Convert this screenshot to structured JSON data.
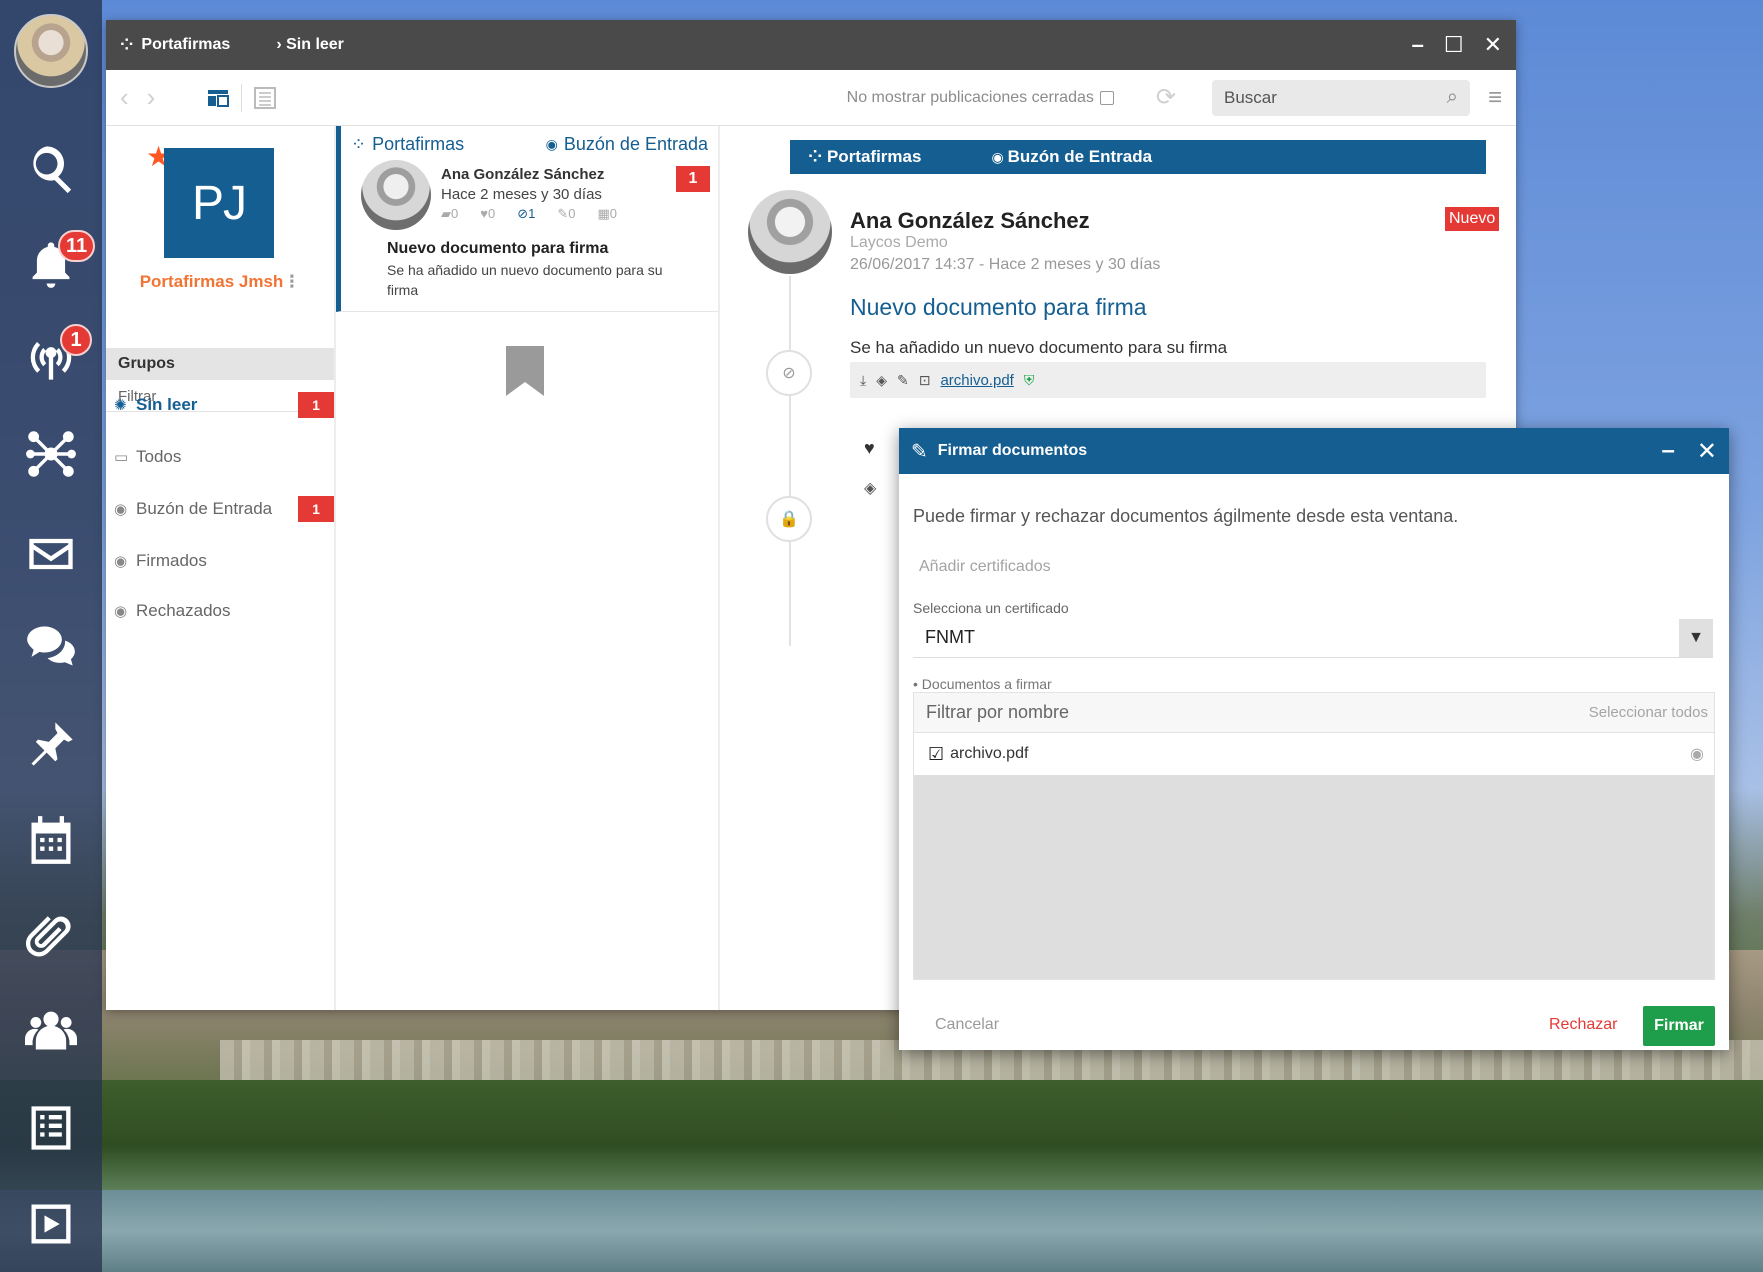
{
  "dock": {
    "notifications_badge": "11",
    "antenna_badge": "1",
    "items": [
      "search-icon",
      "bell-icon",
      "antenna-icon",
      "network-icon",
      "mail-icon",
      "chat-icon",
      "pin-icon",
      "calendar-icon",
      "paperclip-icon",
      "group-icon",
      "list-icon",
      "play-icon"
    ]
  },
  "window": {
    "app_title": "Portafirmas",
    "breadcrumb": "› Sin leer",
    "toolbar": {
      "hide_closed_label": "No mostrar publicaciones cerradas",
      "search_placeholder": "Buscar"
    }
  },
  "profile": {
    "initials": "PJ",
    "name": "Portafirmas Jmsh"
  },
  "groups": {
    "header": "Grupos",
    "filter_placeholder": "Filtrar",
    "items": [
      {
        "label": "Sin leer",
        "badge": "1"
      },
      {
        "label": "Todos",
        "badge": ""
      },
      {
        "label": "Buzón de Entrada",
        "badge": "1"
      },
      {
        "label": "Firmados",
        "badge": ""
      },
      {
        "label": "Rechazados",
        "badge": ""
      }
    ]
  },
  "message_list": {
    "card": {
      "source": "Portafirmas",
      "inbox": "Buzón de Entrada",
      "author": "Ana González Sánchez",
      "time": "Hace 2 meses y 30 días",
      "stats": {
        "comments": "0",
        "likes": "0",
        "attachments": "1",
        "pins": "0",
        "events": "0"
      },
      "badge": "1",
      "title": "Nuevo documento para firma",
      "description": "Se ha añadido un nuevo documento para su firma"
    }
  },
  "detail": {
    "source": "Portafirmas",
    "inbox": "Buzón de Entrada",
    "author": "Ana González Sánchez",
    "organization": "Laycos Demo",
    "date": "26/06/2017 14:37 - Hace 2 meses y 30 días",
    "new_badge": "Nuevo",
    "title": "Nuevo documento para firma",
    "description": "Se ha añadido un nuevo documento para su firma",
    "attachment": "archivo.pdf"
  },
  "sign_dialog": {
    "title": "Firmar documentos",
    "intro": "Puede firmar y rechazar documentos ágilmente desde esta ventana.",
    "add_certificates": "Añadir certificados",
    "select_cert_label": "Selecciona un certificado",
    "selected_cert": "FNMT",
    "documents_label": "• Documentos a firmar",
    "filter_placeholder": "Filtrar por nombre",
    "select_all": "Seleccionar todos",
    "documents": [
      "archivo.pdf"
    ],
    "cancel_label": "Cancelar",
    "reject_label": "Rechazar",
    "sign_label": "Firmar"
  },
  "colors": {
    "brand": "#145e92",
    "badge": "#e53935",
    "accent_orange": "#f07434",
    "sign_green": "#1e9e4a"
  }
}
